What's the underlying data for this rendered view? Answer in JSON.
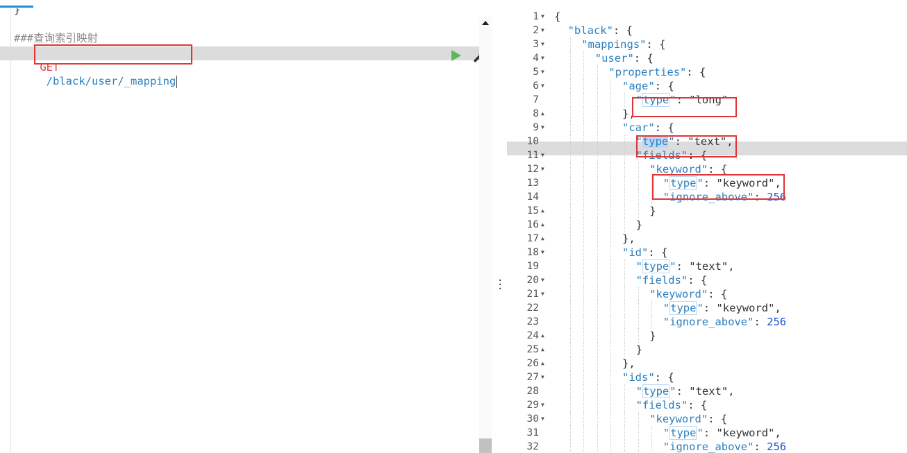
{
  "request": {
    "prev_line": "}",
    "comment": "###查询索引映射",
    "method": "GET",
    "path": "/black/user/_mapping"
  },
  "response": {
    "lines": [
      {
        "n": "1",
        "fold": "down",
        "indent": 0,
        "parts": [
          {
            "t": "{",
            "c": "s"
          }
        ]
      },
      {
        "n": "2",
        "fold": "down",
        "indent": 1,
        "parts": [
          {
            "t": "\"black\"",
            "c": "k"
          },
          {
            "t": ": {",
            "c": "s"
          }
        ]
      },
      {
        "n": "3",
        "fold": "down",
        "indent": 2,
        "parts": [
          {
            "t": "\"mappings\"",
            "c": "k"
          },
          {
            "t": ": {",
            "c": "s"
          }
        ]
      },
      {
        "n": "4",
        "fold": "down",
        "indent": 3,
        "parts": [
          {
            "t": "\"user\"",
            "c": "k"
          },
          {
            "t": ": {",
            "c": "s"
          }
        ]
      },
      {
        "n": "5",
        "fold": "down",
        "indent": 4,
        "parts": [
          {
            "t": "\"properties\"",
            "c": "k"
          },
          {
            "t": ": {",
            "c": "s"
          }
        ]
      },
      {
        "n": "6",
        "fold": "down",
        "indent": 5,
        "parts": [
          {
            "t": "\"age\"",
            "c": "k"
          },
          {
            "t": ": {",
            "c": "s"
          }
        ]
      },
      {
        "n": "7",
        "fold": "",
        "indent": 6,
        "parts": [
          {
            "t": "\"",
            "c": "k"
          },
          {
            "t": "type",
            "c": "k kb"
          },
          {
            "t": "\"",
            "c": "k"
          },
          {
            "t": ": \"long\"",
            "c": "s"
          }
        ]
      },
      {
        "n": "8",
        "fold": "up",
        "indent": 5,
        "parts": [
          {
            "t": "},",
            "c": "s"
          }
        ]
      },
      {
        "n": "9",
        "fold": "down",
        "indent": 5,
        "parts": [
          {
            "t": "\"car\"",
            "c": "k"
          },
          {
            "t": ": {",
            "c": "s"
          }
        ]
      },
      {
        "n": "10",
        "fold": "",
        "indent": 6,
        "parts": [
          {
            "t": "\"",
            "c": "k"
          },
          {
            "t": "type",
            "c": "k sel"
          },
          {
            "t": "\"",
            "c": "k"
          },
          {
            "t": ": \"text\",",
            "c": "s"
          }
        ]
      },
      {
        "n": "11",
        "fold": "down",
        "indent": 6,
        "parts": [
          {
            "t": "\"fields\"",
            "c": "k"
          },
          {
            "t": ": {",
            "c": "s"
          }
        ]
      },
      {
        "n": "12",
        "fold": "down",
        "indent": 7,
        "parts": [
          {
            "t": "\"keyword\"",
            "c": "k"
          },
          {
            "t": ": {",
            "c": "s"
          }
        ]
      },
      {
        "n": "13",
        "fold": "",
        "indent": 8,
        "parts": [
          {
            "t": "\"",
            "c": "k"
          },
          {
            "t": "type",
            "c": "k kb"
          },
          {
            "t": "\"",
            "c": "k"
          },
          {
            "t": ": \"keyword\",",
            "c": "s"
          }
        ]
      },
      {
        "n": "14",
        "fold": "",
        "indent": 8,
        "parts": [
          {
            "t": "\"ignore_above\"",
            "c": "k"
          },
          {
            "t": ": ",
            "c": "s"
          },
          {
            "t": "256",
            "c": "n"
          }
        ]
      },
      {
        "n": "15",
        "fold": "up",
        "indent": 7,
        "parts": [
          {
            "t": "}",
            "c": "s"
          }
        ]
      },
      {
        "n": "16",
        "fold": "up",
        "indent": 6,
        "parts": [
          {
            "t": "}",
            "c": "s"
          }
        ]
      },
      {
        "n": "17",
        "fold": "up",
        "indent": 5,
        "parts": [
          {
            "t": "},",
            "c": "s"
          }
        ]
      },
      {
        "n": "18",
        "fold": "down",
        "indent": 5,
        "parts": [
          {
            "t": "\"id\"",
            "c": "k"
          },
          {
            "t": ": {",
            "c": "s"
          }
        ]
      },
      {
        "n": "19",
        "fold": "",
        "indent": 6,
        "parts": [
          {
            "t": "\"",
            "c": "k"
          },
          {
            "t": "type",
            "c": "k kb"
          },
          {
            "t": "\"",
            "c": "k"
          },
          {
            "t": ": \"text\",",
            "c": "s"
          }
        ]
      },
      {
        "n": "20",
        "fold": "down",
        "indent": 6,
        "parts": [
          {
            "t": "\"fields\"",
            "c": "k"
          },
          {
            "t": ": {",
            "c": "s"
          }
        ]
      },
      {
        "n": "21",
        "fold": "down",
        "indent": 7,
        "parts": [
          {
            "t": "\"keyword\"",
            "c": "k"
          },
          {
            "t": ": {",
            "c": "s"
          }
        ]
      },
      {
        "n": "22",
        "fold": "",
        "indent": 8,
        "parts": [
          {
            "t": "\"",
            "c": "k"
          },
          {
            "t": "type",
            "c": "k kb"
          },
          {
            "t": "\"",
            "c": "k"
          },
          {
            "t": ": \"keyword\",",
            "c": "s"
          }
        ]
      },
      {
        "n": "23",
        "fold": "",
        "indent": 8,
        "parts": [
          {
            "t": "\"ignore_above\"",
            "c": "k"
          },
          {
            "t": ": ",
            "c": "s"
          },
          {
            "t": "256",
            "c": "n"
          }
        ]
      },
      {
        "n": "24",
        "fold": "up",
        "indent": 7,
        "parts": [
          {
            "t": "}",
            "c": "s"
          }
        ]
      },
      {
        "n": "25",
        "fold": "up",
        "indent": 6,
        "parts": [
          {
            "t": "}",
            "c": "s"
          }
        ]
      },
      {
        "n": "26",
        "fold": "up",
        "indent": 5,
        "parts": [
          {
            "t": "},",
            "c": "s"
          }
        ]
      },
      {
        "n": "27",
        "fold": "down",
        "indent": 5,
        "parts": [
          {
            "t": "\"ids\"",
            "c": "k"
          },
          {
            "t": ": {",
            "c": "s"
          }
        ]
      },
      {
        "n": "28",
        "fold": "",
        "indent": 6,
        "parts": [
          {
            "t": "\"",
            "c": "k"
          },
          {
            "t": "type",
            "c": "k kb"
          },
          {
            "t": "\"",
            "c": "k"
          },
          {
            "t": ": \"text\",",
            "c": "s"
          }
        ]
      },
      {
        "n": "29",
        "fold": "down",
        "indent": 6,
        "parts": [
          {
            "t": "\"fields\"",
            "c": "k"
          },
          {
            "t": ": {",
            "c": "s"
          }
        ]
      },
      {
        "n": "30",
        "fold": "down",
        "indent": 7,
        "parts": [
          {
            "t": "\"keyword\"",
            "c": "k"
          },
          {
            "t": ": {",
            "c": "s"
          }
        ]
      },
      {
        "n": "31",
        "fold": "",
        "indent": 8,
        "parts": [
          {
            "t": "\"",
            "c": "k"
          },
          {
            "t": "type",
            "c": "k kb"
          },
          {
            "t": "\"",
            "c": "k"
          },
          {
            "t": ": \"keyword\",",
            "c": "s"
          }
        ]
      },
      {
        "n": "32",
        "fold": "",
        "indent": 8,
        "parts": [
          {
            "t": "\"ignore_above\"",
            "c": "k"
          },
          {
            "t": ": ",
            "c": "s"
          },
          {
            "t": "256",
            "c": "n"
          }
        ]
      }
    ]
  },
  "icons": {
    "run": "play-icon",
    "settings": "wrench-icon"
  },
  "colors": {
    "highlight_box": "#e03535",
    "run_button": "#5cb85c",
    "key": "#2a7fc0",
    "method": "#e04040"
  }
}
